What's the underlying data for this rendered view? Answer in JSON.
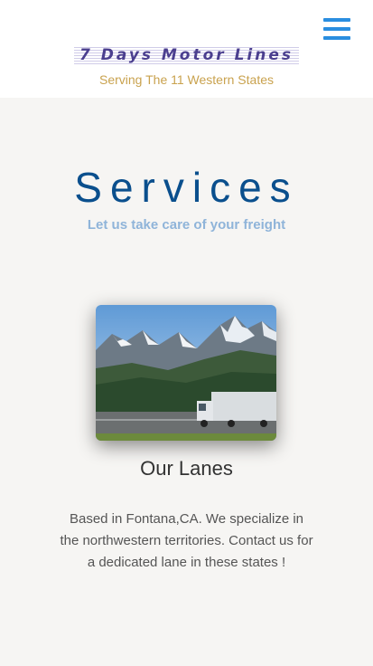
{
  "header": {
    "logo_text": "7 Days Motor Lines",
    "tagline": "Serving The 11 Western States",
    "menu_icon": "hamburger-menu-icon",
    "accent_color": "#2a8ee0"
  },
  "services": {
    "title": "Services",
    "subtitle": "Let us take care of your freight",
    "title_color": "#0a4f8d"
  },
  "card": {
    "image": "mountain-truck-image",
    "title": "Our Lanes",
    "text": "Based in Fontana,CA. We specialize in the northwestern territories. Contact us for a dedicated lane in these states !"
  }
}
